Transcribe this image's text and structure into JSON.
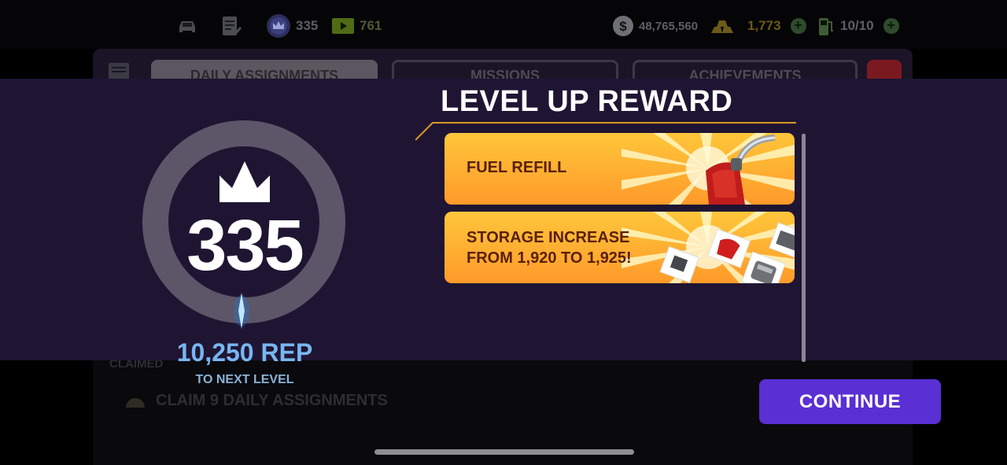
{
  "hud": {
    "level": "335",
    "tickets": "761",
    "cash": "48,765,560",
    "gold": "1,773",
    "fuel": "10/10"
  },
  "background": {
    "tabs": [
      "DAILY ASSIGNMENTS",
      "MISSIONS",
      "ACHIEVEMENTS"
    ],
    "claimed_label": "CLAIMED",
    "task_label": "CLAIM 9 DAILY ASSIGNMENTS"
  },
  "level_panel": {
    "level": "335",
    "rep": "10,250 REP",
    "to_next": "TO NEXT LEVEL"
  },
  "rewards": {
    "title": "LEVEL UP REWARD",
    "items": [
      {
        "line1": "FUEL REFILL",
        "line2": ""
      },
      {
        "line1": "STORAGE INCREASE",
        "line2": "FROM 1,920 TO 1,925!"
      }
    ]
  },
  "continue_label": "CONTINUE",
  "colors": {
    "band": "#1f1533",
    "continue": "#5a2fd4",
    "card_top": "#ffc63a",
    "card_bottom": "#ff9a2a",
    "rep": "#78b6f0"
  }
}
